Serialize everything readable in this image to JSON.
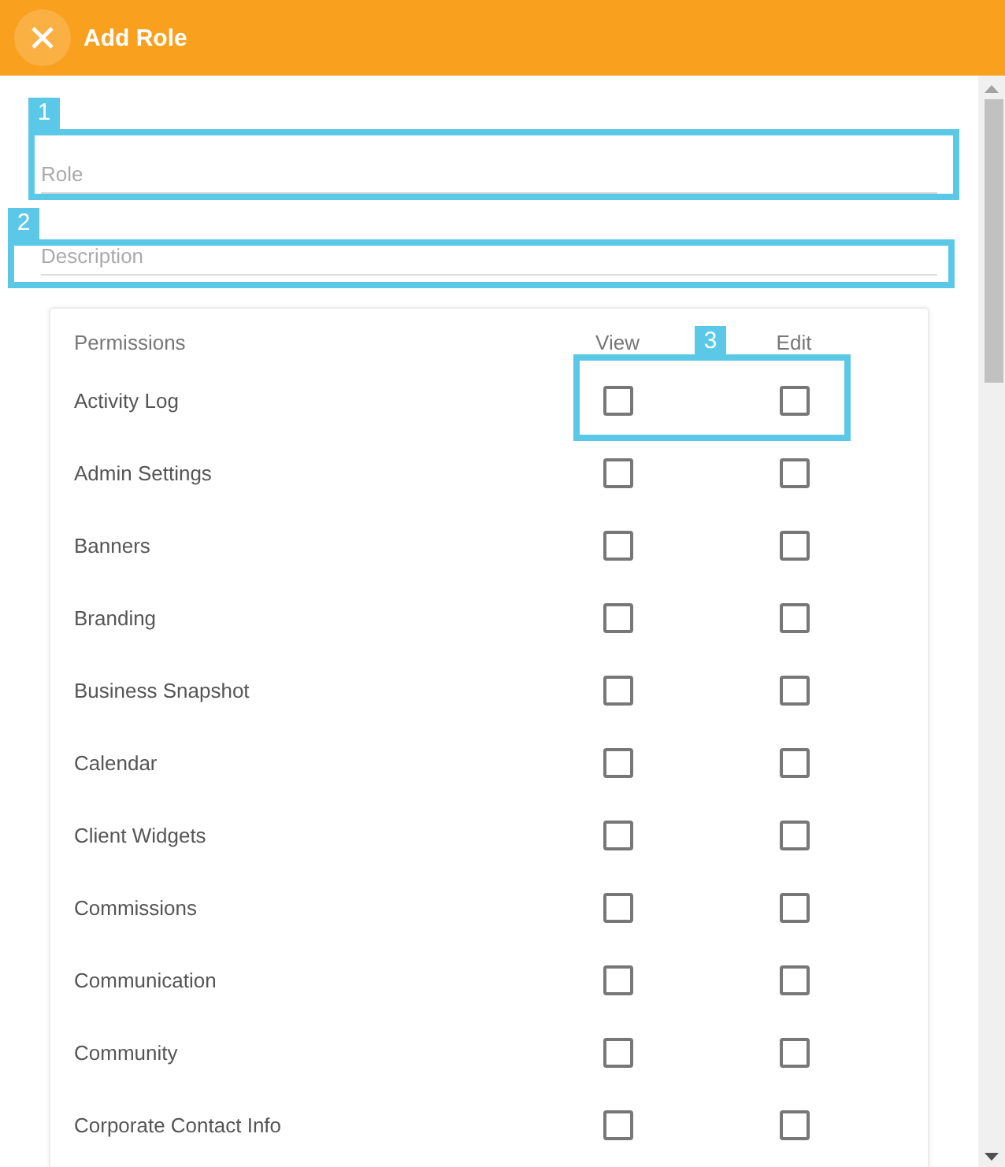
{
  "header": {
    "title": "Add Role"
  },
  "fields": [
    {
      "placeholder": "Role",
      "callout": "1"
    },
    {
      "placeholder": "Description",
      "callout": "2"
    }
  ],
  "permissions": {
    "columns": [
      "Permissions",
      "View",
      "Edit"
    ],
    "callout": "3",
    "rows": [
      {
        "name": "Activity Log",
        "view": false,
        "edit": false
      },
      {
        "name": "Admin Settings",
        "view": false,
        "edit": false
      },
      {
        "name": "Banners",
        "view": false,
        "edit": false
      },
      {
        "name": "Branding",
        "view": false,
        "edit": false
      },
      {
        "name": "Business Snapshot",
        "view": false,
        "edit": false
      },
      {
        "name": "Calendar",
        "view": false,
        "edit": false
      },
      {
        "name": "Client Widgets",
        "view": false,
        "edit": false
      },
      {
        "name": "Commissions",
        "view": false,
        "edit": false
      },
      {
        "name": "Communication",
        "view": false,
        "edit": false
      },
      {
        "name": "Community",
        "view": false,
        "edit": false
      },
      {
        "name": "Corporate Contact Info",
        "view": false,
        "edit": false
      }
    ]
  }
}
